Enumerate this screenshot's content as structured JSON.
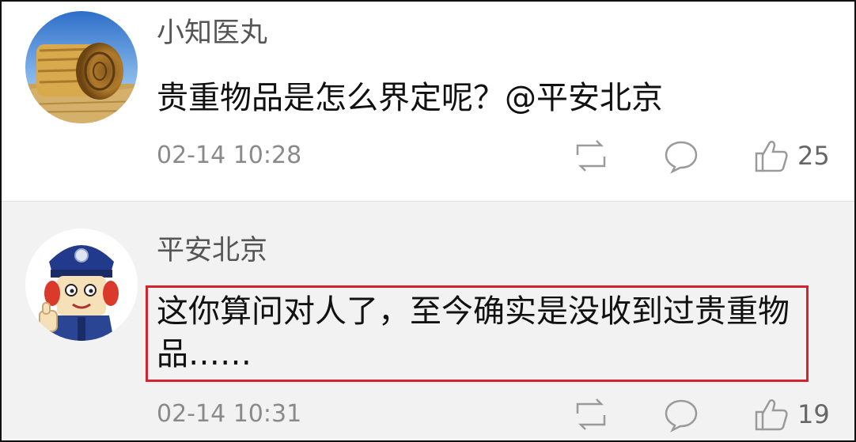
{
  "comments": [
    {
      "username": "小知医丸",
      "text": "贵重物品是怎么界定呢？@平安北京",
      "time": "02-14 10:28",
      "likes": "25",
      "avatar": "hay-bale-photo"
    },
    {
      "username": "平安北京",
      "text": "这你算问对人了，至今确实是没收到过贵重物品……",
      "time": "02-14 10:31",
      "likes": "19",
      "avatar": "cartoon-police-officer",
      "highlighted": true
    }
  ],
  "icons": {
    "repost": "repost-icon",
    "reply": "comment-bubble-icon",
    "like": "thumbs-up-icon"
  },
  "colors": {
    "highlight_border": "#d32330",
    "meta_text": "#8a8a8a",
    "alt_row_background": "#f2f2f2"
  }
}
